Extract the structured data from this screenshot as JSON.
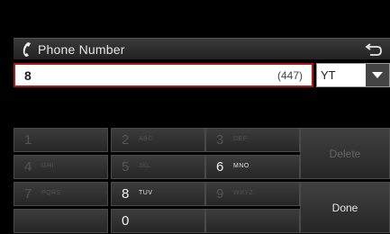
{
  "header": {
    "title": "Phone Number",
    "phone_icon": "phone-icon",
    "back_icon": "back-arrow-icon"
  },
  "input": {
    "value": "8",
    "remaining": "(447)"
  },
  "country": {
    "selected": "YT",
    "dropdown_icon": "triangle-down-icon"
  },
  "keypad": {
    "keys": [
      {
        "num": "1",
        "letters": "",
        "active": false
      },
      {
        "num": "2",
        "letters": "ABC",
        "active": false
      },
      {
        "num": "3",
        "letters": "DEF",
        "active": false
      },
      {
        "num": "4",
        "letters": "GHI",
        "active": false
      },
      {
        "num": "5",
        "letters": "JKL",
        "active": false
      },
      {
        "num": "6",
        "letters": "MNO",
        "active": true
      },
      {
        "num": "7",
        "letters": "PQRS",
        "active": false
      },
      {
        "num": "8",
        "letters": "TUV",
        "active": true
      },
      {
        "num": "9",
        "letters": "WXYZ",
        "active": false
      },
      {
        "num": "",
        "letters": "",
        "active": false
      },
      {
        "num": "0",
        "letters": "",
        "active": true
      },
      {
        "num": "",
        "letters": "",
        "active": false
      }
    ],
    "delete_label": "Delete",
    "done_label": "Done"
  }
}
